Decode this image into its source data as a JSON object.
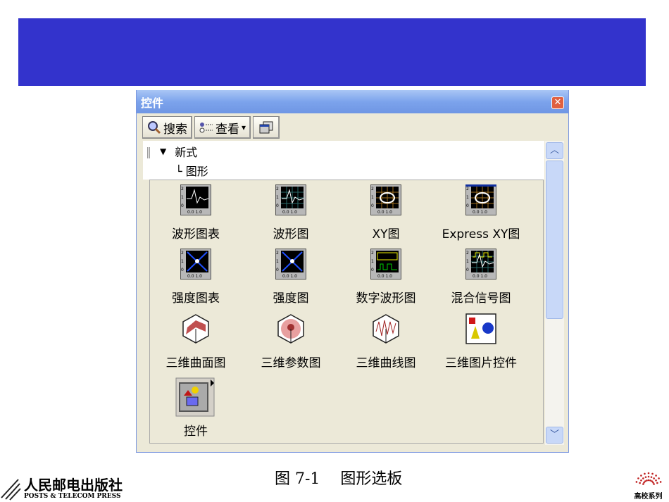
{
  "window": {
    "title": "控件",
    "close": "✕"
  },
  "toolbar": {
    "search": "搜索",
    "view": "查看",
    "view_arrow": "▾"
  },
  "tree": {
    "expander": "▼",
    "category": "新式",
    "subcategory": "└ 图形"
  },
  "items": [
    {
      "label": "波形图表",
      "icon": "waveform-chart-icon"
    },
    {
      "label": "波形图",
      "icon": "waveform-graph-icon"
    },
    {
      "label": "XY图",
      "icon": "xy-graph-icon"
    },
    {
      "label": "Express XY图",
      "icon": "express-xy-graph-icon"
    },
    {
      "label": "强度图表",
      "icon": "intensity-chart-icon"
    },
    {
      "label": "强度图",
      "icon": "intensity-graph-icon"
    },
    {
      "label": "数字波形图",
      "icon": "digital-waveform-icon"
    },
    {
      "label": "混合信号图",
      "icon": "mixed-signal-icon"
    },
    {
      "label": "三维曲面图",
      "icon": "3d-surface-icon"
    },
    {
      "label": "三维参数图",
      "icon": "3d-parametric-icon"
    },
    {
      "label": "三维曲线图",
      "icon": "3d-curve-icon"
    },
    {
      "label": "三维图片控件",
      "icon": "3d-picture-icon"
    },
    {
      "label": "控件",
      "icon": "controls-icon"
    }
  ],
  "caption": "图 7-1　 图形选板",
  "publisher": {
    "cn": "人民邮电出版社",
    "en": "POSTS & TELECOM PRESS"
  },
  "series": "高校系列",
  "colors": {
    "banner": "#3333cc",
    "palette": "#ece9d8"
  }
}
